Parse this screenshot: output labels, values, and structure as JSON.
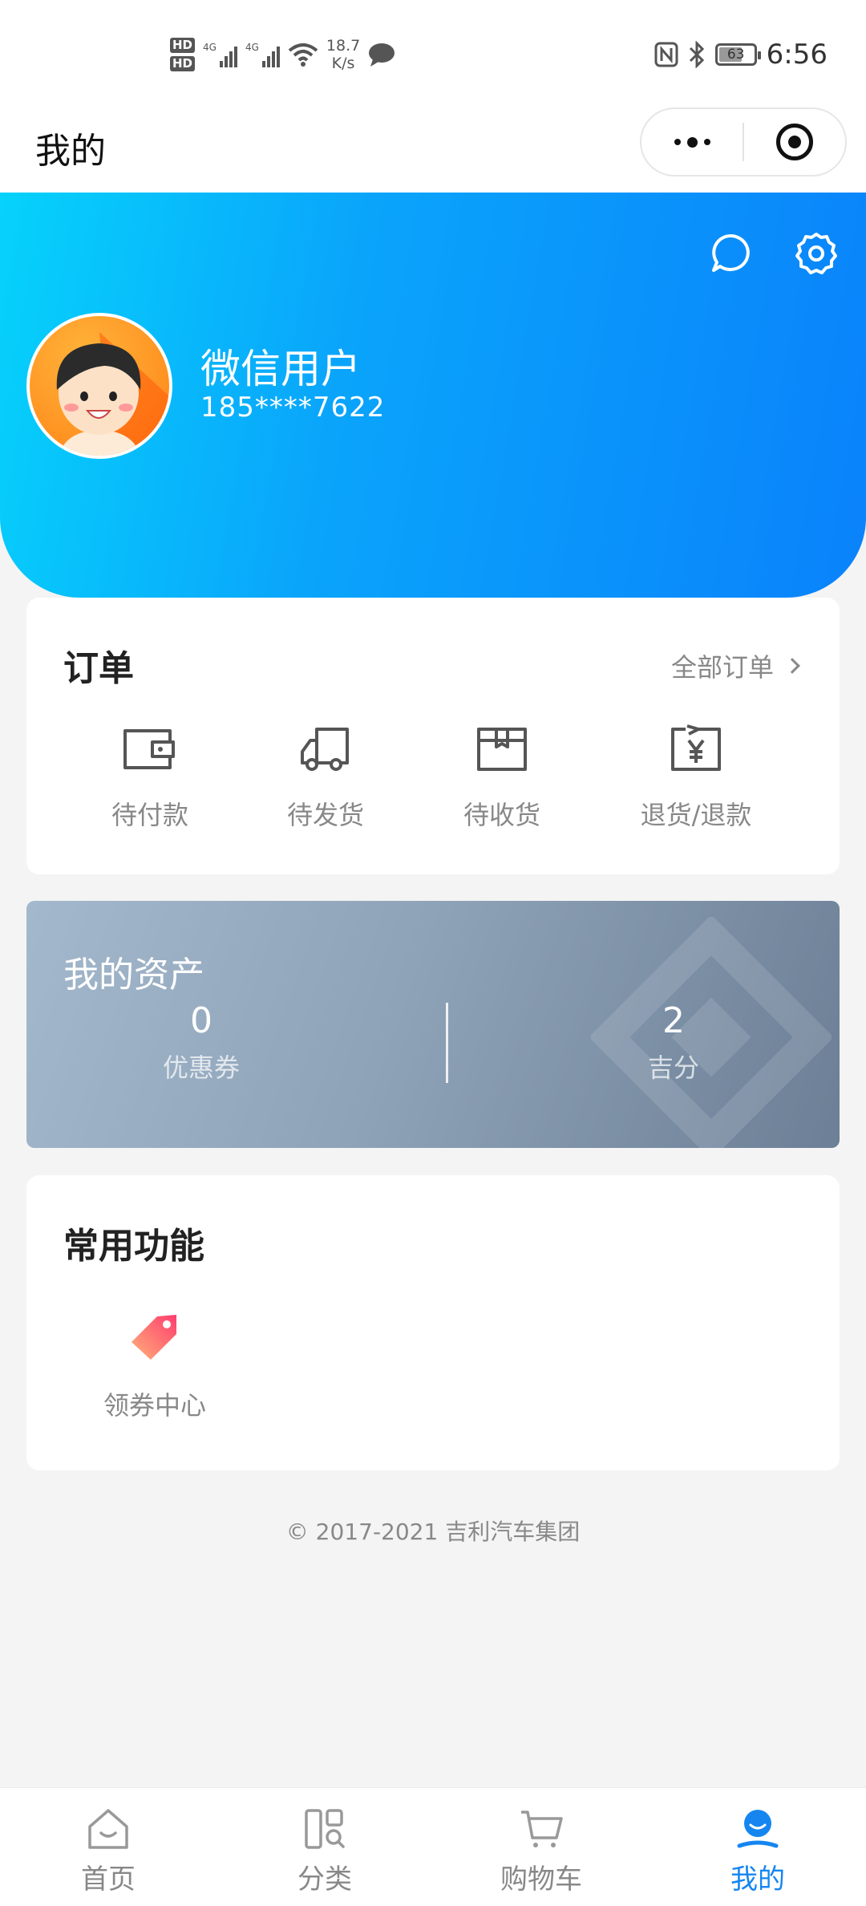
{
  "status_bar": {
    "hd1": "HD",
    "hd2": "HD",
    "net1": "4G",
    "net2": "4G",
    "speed_value": "18.7",
    "speed_unit": "K/s",
    "battery": "63",
    "time": "6:56"
  },
  "nav": {
    "title": "我的"
  },
  "profile": {
    "name": "微信用户",
    "phone": "185****7622"
  },
  "orders": {
    "title": "订单",
    "all_label": "全部订单",
    "items": [
      {
        "label": "待付款",
        "icon": "wallet-icon"
      },
      {
        "label": "待发货",
        "icon": "truck-icon"
      },
      {
        "label": "待收货",
        "icon": "package-icon"
      },
      {
        "label": "退货/退款",
        "icon": "refund-icon"
      }
    ]
  },
  "assets": {
    "title": "我的资产",
    "coupons": {
      "value": "0",
      "label": "优惠券"
    },
    "points": {
      "value": "2",
      "label": "吉分"
    }
  },
  "functions": {
    "title": "常用功能",
    "items": [
      {
        "label": "领券中心",
        "icon": "coupon-tag-icon"
      }
    ]
  },
  "footer": {
    "copyright": "© 2017-2021 吉利汽车集团"
  },
  "tabs": [
    {
      "label": "首页",
      "icon": "home-icon",
      "active": false
    },
    {
      "label": "分类",
      "icon": "category-icon",
      "active": false
    },
    {
      "label": "购物车",
      "icon": "cart-icon",
      "active": false
    },
    {
      "label": "我的",
      "icon": "profile-icon",
      "active": true
    }
  ],
  "colors": {
    "accent": "#1586f0",
    "header_gradient_start": "#06d2fb",
    "header_gradient_end": "#0a82fb"
  }
}
